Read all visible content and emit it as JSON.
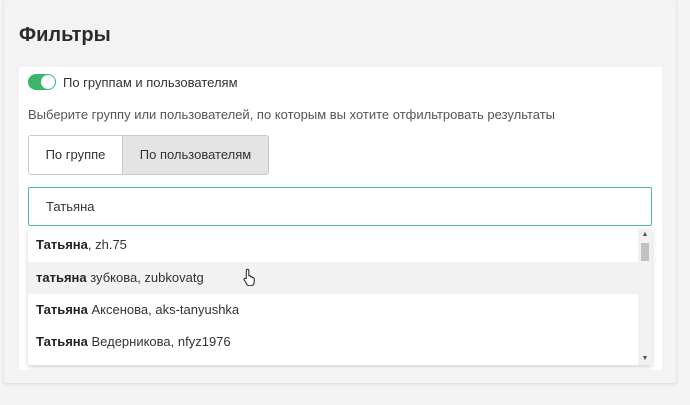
{
  "page": {
    "title": "Фильтры"
  },
  "filter": {
    "toggle_label": "По группам и пользователям",
    "toggle_on": true,
    "hint": "Выберите группу или пользователей, по которым вы хотите отфильтровать результаты",
    "modes": [
      "По группе",
      "По пользователям"
    ],
    "active_mode": "По пользователям"
  },
  "search": {
    "value": "Татьяна"
  },
  "suggestions": [
    {
      "match": "Татьяна",
      "rest": ", zh.75"
    },
    {
      "match": "татьяна",
      "rest": " зубкова, zubkovatg"
    },
    {
      "match": "Татьяна",
      "rest": " Аксенова, aks-tanyushka"
    },
    {
      "match": "Татьяна",
      "rest": " Ведерникова, nfyz1976"
    }
  ],
  "hovered_suggestion": 1,
  "icons": {
    "scroll_up": "▲",
    "scroll_down": "▼",
    "cursor": "hand-pointer-icon"
  },
  "colors": {
    "toggle_on": "#3bb56a",
    "search_border": "#53b98a",
    "active_segment": "#e4e4e4"
  }
}
